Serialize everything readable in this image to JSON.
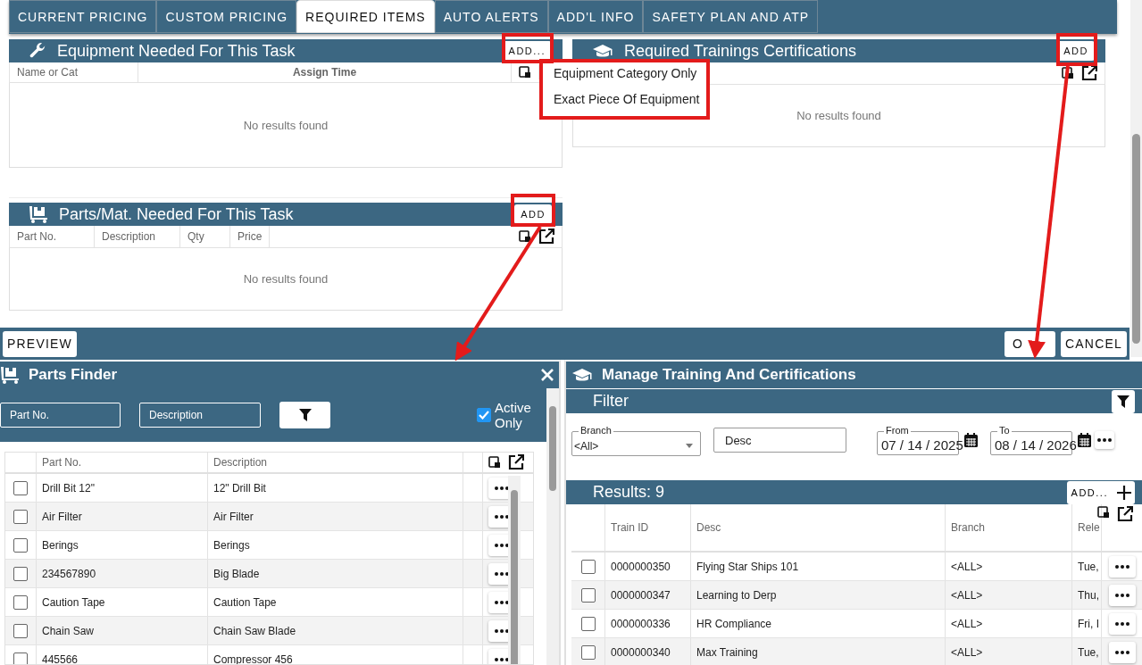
{
  "tabs": [
    {
      "label": "CURRENT PRICING",
      "selected": false
    },
    {
      "label": "CUSTOM PRICING",
      "selected": false
    },
    {
      "label": "REQUIRED ITEMS",
      "selected": true
    },
    {
      "label": "AUTO ALERTS",
      "selected": false
    },
    {
      "label": "ADD'L INFO",
      "selected": false
    },
    {
      "label": "SAFETY PLAN AND ATP",
      "selected": false
    }
  ],
  "equipment_panel": {
    "title": "Equipment Needed For This Task",
    "add_button": "ADD...",
    "columns": [
      "Name or Cat",
      "Assign Time"
    ],
    "empty_text": "No results found"
  },
  "add_menu": {
    "items": [
      "Equipment Category Only",
      "Exact Piece Of Equipment"
    ]
  },
  "trainings_panel": {
    "title": "Required Trainings Certifications",
    "add_button": "ADD",
    "empty_text": "No results found"
  },
  "parts_panel": {
    "title": "Parts/Mat. Needed For This Task",
    "add_button": "ADD",
    "columns": [
      "Part No.",
      "Description",
      "Qty",
      "Price"
    ],
    "empty_text": "No results found"
  },
  "footer": {
    "left_buttons": [
      "PREVIEW"
    ],
    "right_buttons": [
      "O",
      "CANCEL"
    ]
  },
  "parts_finder": {
    "title": "Parts Finder",
    "filters": [
      {
        "placeholder": "Part No."
      },
      {
        "placeholder": "Description"
      }
    ],
    "active_only": {
      "label": "Active Only",
      "checked": true
    },
    "columns": [
      "Part No.",
      "Description"
    ],
    "rows": [
      {
        "checked": false,
        "part_no": "Drill Bit 12\"",
        "description": "12\" Drill Bit"
      },
      {
        "checked": false,
        "part_no": "Air Filter",
        "description": "Air Filter"
      },
      {
        "checked": false,
        "part_no": "Berings",
        "description": "Berings"
      },
      {
        "checked": false,
        "part_no": "234567890",
        "description": "Big Blade"
      },
      {
        "checked": false,
        "part_no": "Caution Tape",
        "description": "Caution Tape"
      },
      {
        "checked": false,
        "part_no": "Chain Saw",
        "description": "Chain Saw Blade"
      },
      {
        "checked": false,
        "part_no": "445566",
        "description": "Compressor 456"
      }
    ]
  },
  "training_dialog": {
    "title": "Manage Training And Certifications",
    "filter_title": "Filter",
    "branch": {
      "label": "Branch",
      "value": "<All>"
    },
    "desc": {
      "placeholder": "Desc"
    },
    "from": {
      "label": "From",
      "value": "07 / 14 / 2025"
    },
    "to": {
      "label": "To",
      "value": "08 / 14 / 2026"
    },
    "results_title": "Results: 9",
    "add_button": "ADD...",
    "columns": [
      "Train ID",
      "Desc",
      "Branch",
      "Rele"
    ],
    "rows": [
      {
        "checked": false,
        "train_id": "0000000350",
        "desc": "Flying Star Ships 101",
        "branch": "<ALL>",
        "column_4": "Tue,"
      },
      {
        "checked": false,
        "train_id": "0000000347",
        "desc": "Learning to Derp",
        "branch": "<ALL>",
        "column_4": "Thu,"
      },
      {
        "checked": false,
        "train_id": "0000000336",
        "desc": "HR Compliance",
        "branch": "<ALL>",
        "column_4": "Fri, I"
      },
      {
        "checked": false,
        "train_id": "0000000340",
        "desc": "Max Training",
        "branch": "<ALL>",
        "column_4": "Tue,"
      }
    ]
  }
}
